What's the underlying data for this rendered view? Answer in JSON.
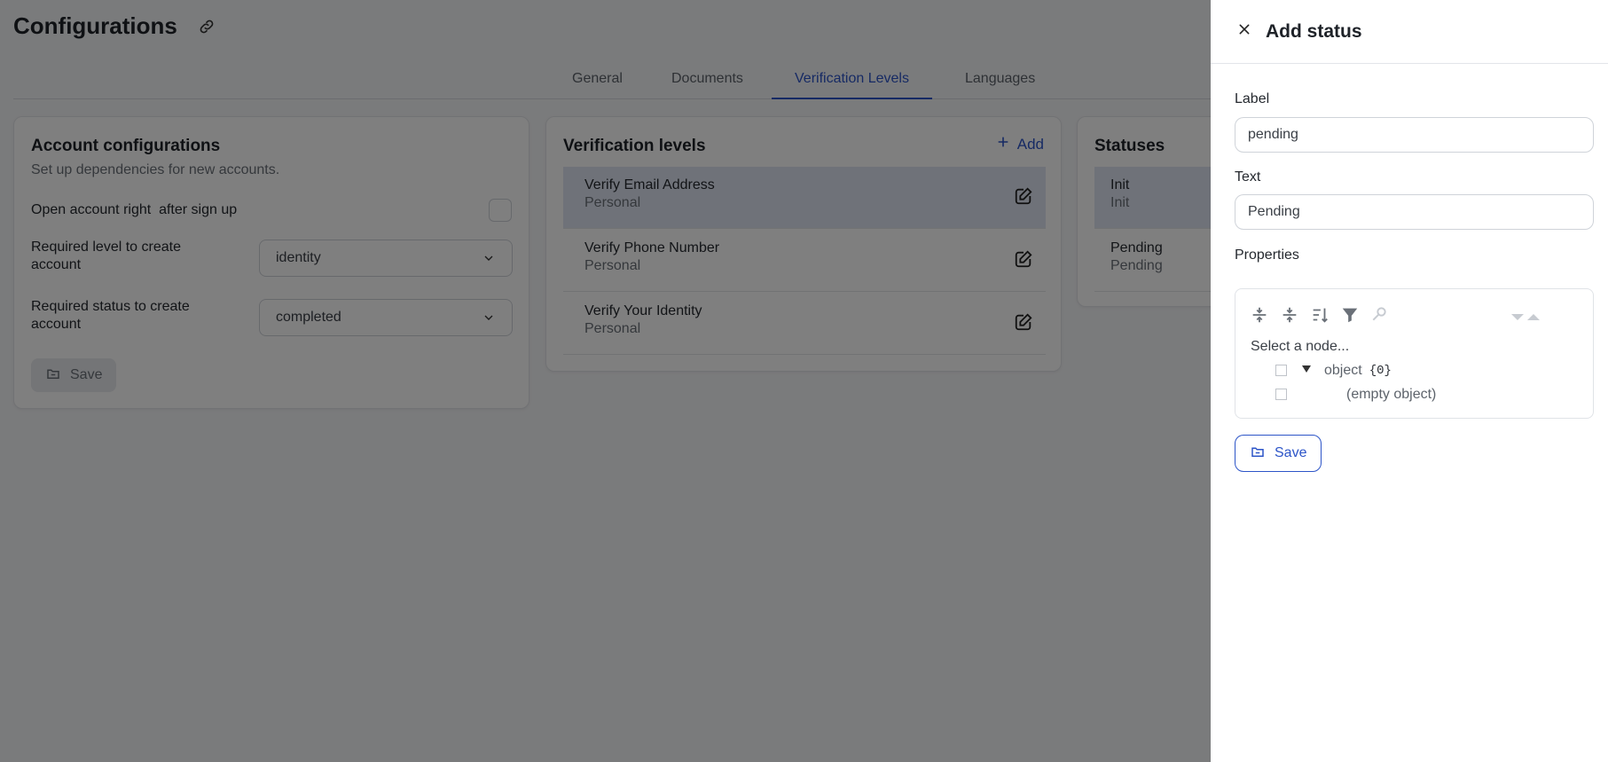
{
  "page": {
    "title": "Configurations"
  },
  "tabs": [
    "General",
    "Documents",
    "Verification Levels",
    "Languages"
  ],
  "account": {
    "title": "Account configurations",
    "subtitle": "Set up dependencies for new accounts.",
    "open_label": "Open account right  after sign up",
    "level_label": "Required level to create account",
    "level_value": "identity",
    "status_label": "Required status to create account",
    "status_value": "completed",
    "save_label": "Save"
  },
  "verification": {
    "title": "Verification levels",
    "add_label": "Add",
    "items": [
      {
        "title": "Verify Email Address",
        "sub": "Personal"
      },
      {
        "title": "Verify Phone Number",
        "sub": "Personal"
      },
      {
        "title": "Verify Your Identity",
        "sub": "Personal"
      }
    ]
  },
  "statuses": {
    "title": "Statuses",
    "items": [
      {
        "title": "Init",
        "sub": "Init"
      },
      {
        "title": "Pending",
        "sub": "Pending"
      }
    ]
  },
  "drawer": {
    "title": "Add status",
    "label_label": "Label",
    "label_value": "pending",
    "text_label": "Text",
    "text_value": "Pending",
    "properties_label": "Properties",
    "json_hint": "Select a node...",
    "json_root_key": "object",
    "json_root_count": "{0}",
    "json_empty": "(empty object)",
    "save_label": "Save"
  },
  "colors": {
    "accent": "#2d55c8",
    "overlay": "rgba(0,0,0,0.5)"
  }
}
